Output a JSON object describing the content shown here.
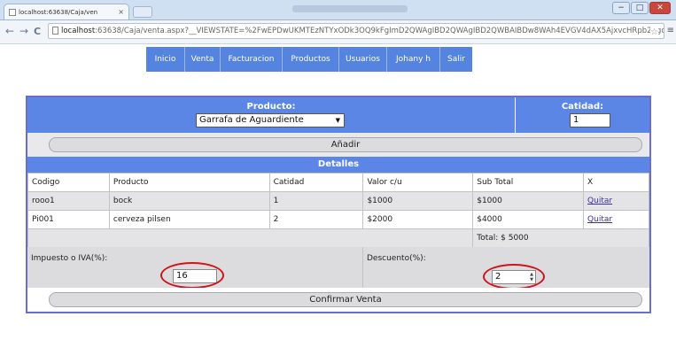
{
  "browser": {
    "tab_title": "localhost:63638/Caja/ven",
    "tab_close": "×",
    "url_host": "localhost",
    "url_rest": ":63638/Caja/venta.aspx?__VIEWSTATE=%2FwEPDwUKMTEzNTYxODk3OQ9kFgImD2QWAgIBD2QWAgIBD2QWBAIBDw8WAh4EVGV4dAX5AjxvcHRpb24gdmFsdWU9",
    "back": "←",
    "forward": "→",
    "reload": "C",
    "star": "☆",
    "more": "≡",
    "min": "−",
    "max": "□",
    "close": "✕"
  },
  "nav": {
    "items": [
      {
        "label": "Inicio"
      },
      {
        "label": "Venta"
      },
      {
        "label": "Facturacion"
      },
      {
        "label": "Productos"
      },
      {
        "label": "Usuarios"
      },
      {
        "label": "Johany h"
      },
      {
        "label": "Salir"
      }
    ]
  },
  "form": {
    "product_label": "Producto:",
    "product_selected": "Garrafa de Aguardiente",
    "select_arrow": "▼",
    "qty_label": "Catidad:",
    "qty_value": "1",
    "add_button": "Añadir",
    "details_title": "Detalles",
    "table": {
      "headers": [
        "Codigo",
        "Producto",
        "Catidad",
        "Valor c/u",
        "Sub Total",
        "X"
      ],
      "rows": [
        [
          "rooo1",
          "bock",
          "1",
          "$1000",
          "$1000",
          "Quitar"
        ],
        [
          "Pi001",
          "cerveza pilsen",
          "2",
          "$2000",
          "$4000",
          "Quitar"
        ]
      ]
    },
    "total": "Total: $ 5000",
    "tax_label": "Impuesto o IVA(%):",
    "tax_value": "16",
    "discount_label": "Descuento(%):",
    "discount_value": "2",
    "confirm_button": "Confirmar Venta"
  },
  "colors": {
    "nav_bg": "#5583e0",
    "header_bg": "#5b86e6",
    "panel_border": "#6a6ec9",
    "highlight_ring": "#d0131a"
  }
}
